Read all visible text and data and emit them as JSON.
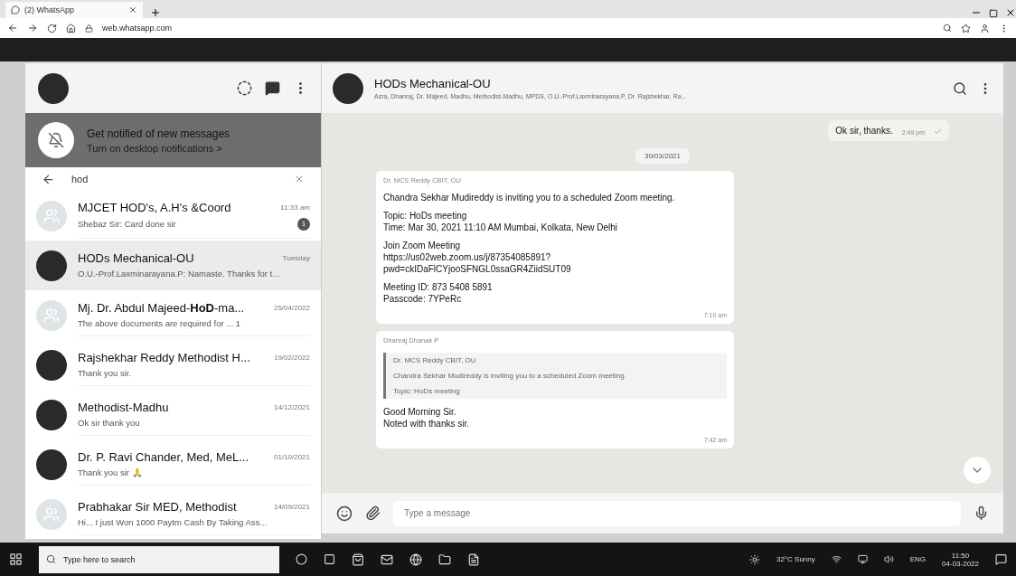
{
  "browser": {
    "tab_title": "(2) WhatsApp",
    "url": "web.whatsapp.com"
  },
  "banner": {
    "title": "Get notified of new messages",
    "link": "Turn on desktop notifications >"
  },
  "search": {
    "value": "hod"
  },
  "chats": [
    {
      "name": "MJCET HOD's, A.H's &Coord",
      "time": "11:33 am",
      "preview": "Shebaz Sir: Card done sir",
      "unread": "1",
      "has_photo": false,
      "selected": false
    },
    {
      "name": "HODs Mechanical-OU",
      "time": "Tuesday",
      "preview": "O.U.-Prof.Laxminarayana.P: Namaste. Thanks for t...",
      "has_photo": true,
      "selected": true
    },
    {
      "name": "Mj. Dr. Abdul Majeed-**HoD**-ma...",
      "time": "25/04/2022",
      "preview": "The above documents are required for ... 1",
      "has_photo": false,
      "selected": false
    },
    {
      "name": "Rajshekhar Reddy Methodist H...",
      "time": "19/02/2022",
      "preview": "Thank you sir.",
      "has_photo": true,
      "selected": false
    },
    {
      "name": "Methodist-Madhu",
      "time": "14/12/2021",
      "preview": "Ok sir thank you",
      "has_photo": true,
      "selected": false
    },
    {
      "name": "Dr. P. Ravi Chander, Med, MeL...",
      "time": "01/10/2021",
      "preview": "Thank you sir 🙏",
      "has_photo": true,
      "selected": false
    },
    {
      "name": "Prabhakar Sir MED, Methodist",
      "time": "14/09/2021",
      "preview": "Hi... I just Won 1000 Paytm Cash By Taking Ass...",
      "has_photo": false,
      "selected": false
    }
  ],
  "conversation": {
    "title": "HODs Mechanical-OU",
    "members": "Azra, Dhanraj, Dr. Majeed, Madhu, Methodist-Madhu, MPDS, O.U.-Prof.Laxminarayana.P, Dr. Rajshekhar, Ra...",
    "messages": [
      {
        "kind": "outgoing",
        "text": "Ok sir, thanks.",
        "time": "2:49 pm"
      },
      {
        "kind": "date",
        "text": "30/03/2021"
      },
      {
        "kind": "incoming",
        "sender": "Dr. MCS Reddy CBIT, OU",
        "paragraphs": [
          [
            "Chandra Sekhar Mudireddy is inviting you to a scheduled Zoom meeting."
          ],
          [
            "Topic: HoDs meeting",
            "Time: Mar 30, 2021 11:10 AM Mumbai, Kolkata, New Delhi"
          ],
          [
            "Join Zoom Meeting",
            "https://us02web.zoom.us/j/87354085891?",
            "pwd=ckIDaFlCYjooSFNGL0ssaGR4ZiidSUT09"
          ],
          [
            "Meeting ID: 873 5408 5891",
            "Passcode: 7YPeRc"
          ]
        ],
        "time": "7:10 am"
      },
      {
        "kind": "reply",
        "sender": "Dhanraj Dhanak P",
        "quote_sender": "Dr. MCS Reddy CBIT, OU",
        "quote_lines": [
          "Chandra Sekhar Mudireddy is inviting you to a scheduled Zoom meeting.",
          "Topic: HoDs meeting"
        ],
        "lines": [
          "Good Morning Sir.",
          "Noted with thanks sir."
        ],
        "time": "7:42 am"
      }
    ]
  },
  "composer": {
    "placeholder": "Type a message"
  },
  "taskbar": {
    "search_placeholder": "Type here to search",
    "weather": "32°C Sunny",
    "language": "ENG",
    "time": "11:50",
    "date": "04-03-2022"
  }
}
